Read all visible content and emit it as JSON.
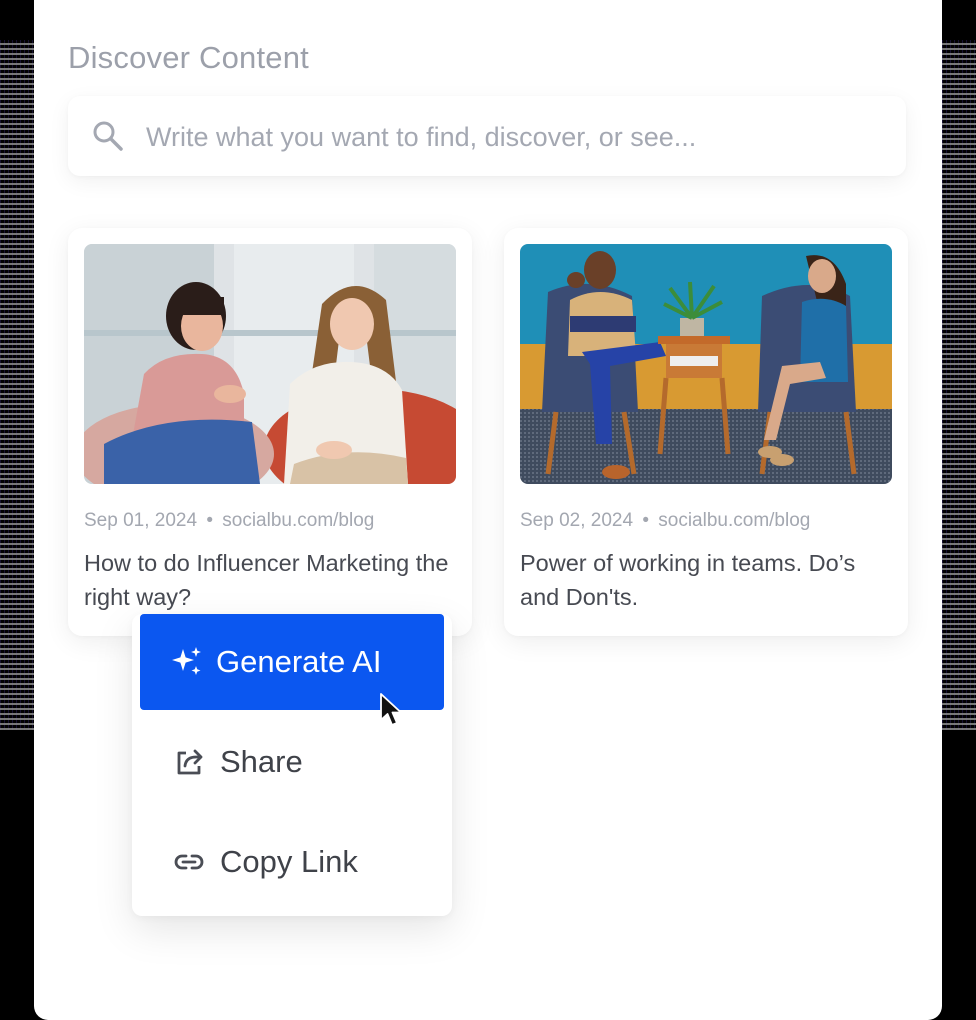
{
  "header": {
    "title": "Discover Content"
  },
  "search": {
    "placeholder": "Write what you want to find, discover, or see...",
    "icon": "search-icon"
  },
  "cards": [
    {
      "date": "Sep 01, 2024",
      "separator": "•",
      "source": "socialbu.com/blog",
      "title": "How to do Influencer Marketing the right way?",
      "image": "two women talking on bean bags"
    },
    {
      "date": "Sep 02, 2024",
      "separator": "•",
      "source": "socialbu.com/blog",
      "title": "Power of working in teams. Do’s and Don'ts.",
      "image": "man and woman talking in armchairs"
    }
  ],
  "menu": {
    "items": [
      {
        "label": "Generate AI",
        "icon": "sparkles-icon",
        "active": true
      },
      {
        "label": "Share",
        "icon": "share-icon"
      },
      {
        "label": "Copy Link",
        "icon": "link-icon"
      }
    ]
  },
  "colors": {
    "accent": "#0b57f0",
    "title": "#9ca0aa",
    "meta": "#a3a7b0",
    "text": "#474a52"
  }
}
